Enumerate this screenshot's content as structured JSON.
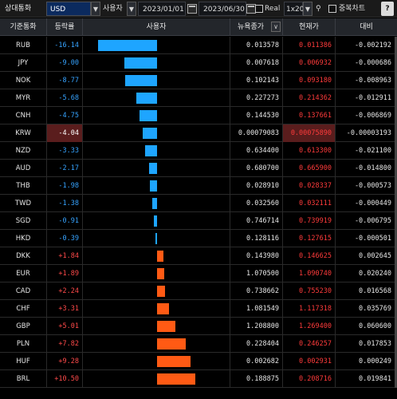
{
  "toolbar": {
    "title": "상대통화",
    "base_currency": "USD",
    "mode": "사용자",
    "start_date": "2023/01/01",
    "end_date": "2023/06/30",
    "real_label": "Real",
    "scale": "1x20",
    "overlay_label": "중복차트",
    "help": "?"
  },
  "columns": [
    "기준통화",
    "등락률",
    "사용자",
    "뉴욕종가",
    "현재가",
    "대비"
  ],
  "scale_max": 10.5,
  "selected_index": 5,
  "rows": [
    {
      "currency": "RUB",
      "rate": -16.14,
      "rate_text": "-16.14",
      "prev": "0.013578",
      "now": "0.011386",
      "diff": "-0.002192"
    },
    {
      "currency": "JPY",
      "rate": -9.0,
      "rate_text": "-9.00",
      "prev": "0.007618",
      "now": "0.006932",
      "diff": "-0.000686"
    },
    {
      "currency": "NOK",
      "rate": -8.77,
      "rate_text": "-8.77",
      "prev": "0.102143",
      "now": "0.093180",
      "diff": "-0.008963"
    },
    {
      "currency": "MYR",
      "rate": -5.68,
      "rate_text": "-5.68",
      "prev": "0.227273",
      "now": "0.214362",
      "diff": "-0.012911"
    },
    {
      "currency": "CNH",
      "rate": -4.75,
      "rate_text": "-4.75",
      "prev": "0.144530",
      "now": "0.137661",
      "diff": "-0.006869"
    },
    {
      "currency": "KRW",
      "rate": -4.04,
      "rate_text": "-4.04",
      "prev": "0.00079083",
      "now": "0.00075890",
      "diff": "-0.00003193"
    },
    {
      "currency": "NZD",
      "rate": -3.33,
      "rate_text": "-3.33",
      "prev": "0.634400",
      "now": "0.613300",
      "diff": "-0.021100"
    },
    {
      "currency": "AUD",
      "rate": -2.17,
      "rate_text": "-2.17",
      "prev": "0.680700",
      "now": "0.665900",
      "diff": "-0.014800"
    },
    {
      "currency": "THB",
      "rate": -1.98,
      "rate_text": "-1.98",
      "prev": "0.028910",
      "now": "0.028337",
      "diff": "-0.000573"
    },
    {
      "currency": "TWD",
      "rate": -1.38,
      "rate_text": "-1.38",
      "prev": "0.032560",
      "now": "0.032111",
      "diff": "-0.000449"
    },
    {
      "currency": "SGD",
      "rate": -0.91,
      "rate_text": "-0.91",
      "prev": "0.746714",
      "now": "0.739919",
      "diff": "-0.006795"
    },
    {
      "currency": "HKD",
      "rate": -0.39,
      "rate_text": "-0.39",
      "prev": "0.128116",
      "now": "0.127615",
      "diff": "-0.000501"
    },
    {
      "currency": "DKK",
      "rate": 1.84,
      "rate_text": "+1.84",
      "prev": "0.143980",
      "now": "0.146625",
      "diff": "0.002645"
    },
    {
      "currency": "EUR",
      "rate": 1.89,
      "rate_text": "+1.89",
      "prev": "1.070500",
      "now": "1.090740",
      "diff": "0.020240"
    },
    {
      "currency": "CAD",
      "rate": 2.24,
      "rate_text": "+2.24",
      "prev": "0.738662",
      "now": "0.755230",
      "diff": "0.016568"
    },
    {
      "currency": "CHF",
      "rate": 3.31,
      "rate_text": "+3.31",
      "prev": "1.081549",
      "now": "1.117318",
      "diff": "0.035769"
    },
    {
      "currency": "GBP",
      "rate": 5.01,
      "rate_text": "+5.01",
      "prev": "1.208800",
      "now": "1.269400",
      "diff": "0.060600"
    },
    {
      "currency": "PLN",
      "rate": 7.82,
      "rate_text": "+7.82",
      "prev": "0.228404",
      "now": "0.246257",
      "diff": "0.017853"
    },
    {
      "currency": "HUF",
      "rate": 9.28,
      "rate_text": "+9.28",
      "prev": "0.002682",
      "now": "0.002931",
      "diff": "0.000249"
    },
    {
      "currency": "BRL",
      "rate": 10.5,
      "rate_text": "+10.50",
      "prev": "0.188875",
      "now": "0.208716",
      "diff": "0.019841"
    }
  ],
  "colors": {
    "down": "#1ea5ff",
    "up": "#ff5a14",
    "selected": "#5a1d1d"
  }
}
